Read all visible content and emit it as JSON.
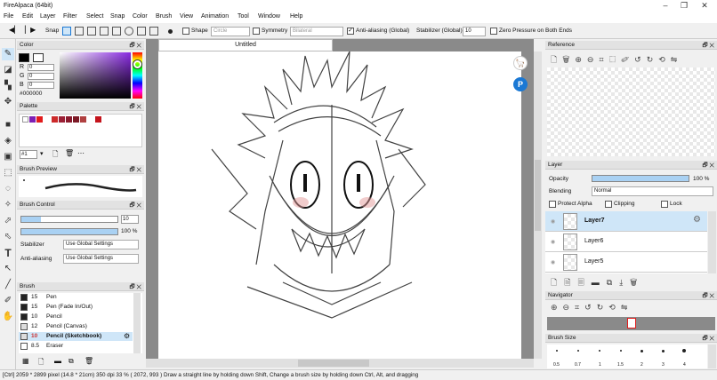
{
  "window": {
    "title": "FireAlpaca (64bit)",
    "minimize": "–",
    "maximize": "❐",
    "close": "✕"
  },
  "menu": [
    "File",
    "Edit",
    "Layer",
    "Filter",
    "Select",
    "Snap",
    "Color",
    "Brush",
    "View",
    "Animation",
    "Tool",
    "Window",
    "Help"
  ],
  "toolbar": {
    "snap_label": "Snap",
    "shape_label": "Shape",
    "shape_value": "Circle",
    "symmetry_label": "Symmetry",
    "symmetry_value": "Bilateral",
    "antialias_label": "Anti-aliasing (Global)",
    "antialias_checked": true,
    "stabilizer_label": "Stabilizer (Global)",
    "stabilizer_value": "10",
    "zero_pressure_label": "Zero Pressure on Both Ends"
  },
  "color_panel": {
    "title": "Color",
    "r_label": "R",
    "r_value": "0",
    "g_label": "G",
    "g_value": "0",
    "b_label": "B",
    "b_value": "0",
    "hex": "#000000"
  },
  "palette_panel": {
    "title": "Palette",
    "page": "#1"
  },
  "brush_preview": {
    "title": "Brush Preview"
  },
  "brush_control": {
    "title": "Brush Control",
    "size_value": "10",
    "opacity_value": "100 %",
    "opacity_fraction": 1.0,
    "stabilizer_label": "Stabilizer",
    "stabilizer_value": "Use Global Settings",
    "antialias_label": "Anti-aliasing",
    "antialias_value": "Use Global Settings"
  },
  "brush_panel": {
    "title": "Brush",
    "items": [
      {
        "size": "15",
        "name": "Pen"
      },
      {
        "size": "15",
        "name": "Pen (Fade In/Out)"
      },
      {
        "size": "10",
        "name": "Pencil"
      },
      {
        "size": "12",
        "name": "Pencil (Canvas)"
      },
      {
        "size": "10",
        "name": "Pencil (Sketchbook)"
      },
      {
        "size": "8.5",
        "name": "Eraser"
      }
    ],
    "selected_index": 4
  },
  "document": {
    "tab_title": "Untitled"
  },
  "reference_panel": {
    "title": "Reference"
  },
  "layer_panel": {
    "title": "Layer",
    "opacity_label": "Opacity",
    "opacity_value": "100 %",
    "opacity_fraction": 1.0,
    "blending_label": "Blending",
    "blending_value": "Normal",
    "protect_alpha_label": "Protect Alpha",
    "clipping_label": "Clipping",
    "lock_label": "Lock",
    "layers": [
      {
        "name": "Layer7",
        "active": true
      },
      {
        "name": "Layer6",
        "active": false
      },
      {
        "name": "Layer5",
        "active": false
      }
    ]
  },
  "navigator_panel": {
    "title": "Navigator"
  },
  "brush_size_panel": {
    "title": "Brush Size",
    "sizes": [
      "0.5",
      "0.7",
      "1",
      "1.5",
      "2",
      "3",
      "4"
    ]
  },
  "status": {
    "mode": "[Ctrl]",
    "info": "2059 * 2899 pixel  (14.8 * 21cm)  350 dpi  33 %  ( 2072, 993 )  Draw a straight line by holding down Shift, Change a brush size by holding down Ctrl, Alt, and dragging"
  },
  "colors": {
    "accent": "#1a78d4",
    "selected_row": "#cfe6f8",
    "bar_fill": "#a9d1f3",
    "canvas_bg": "#8a8a8a"
  },
  "palette_colors": [
    "#ffffff",
    "#7d1fb5",
    "#e21b1b",
    "#cc2a2a",
    "#9b2035",
    "#8a1a2d",
    "#7c1a26",
    "#b04040",
    "#c4141c"
  ]
}
